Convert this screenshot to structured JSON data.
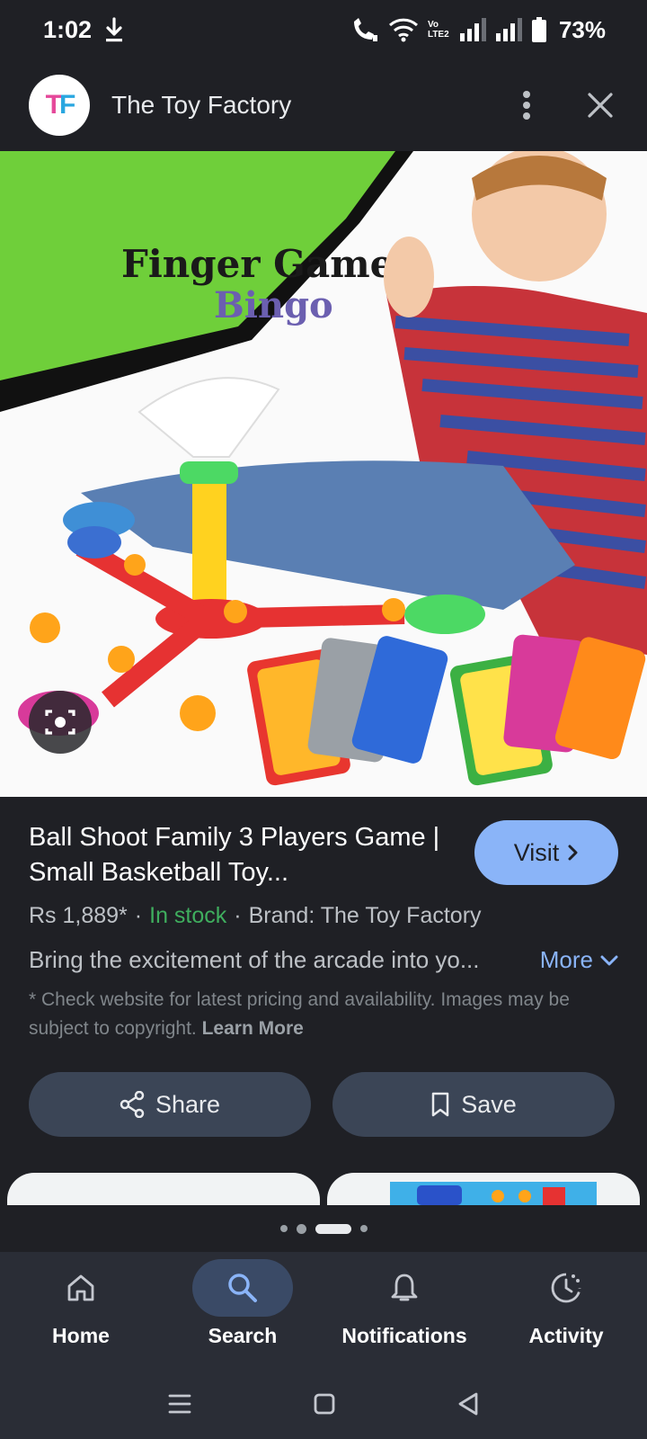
{
  "status": {
    "time": "1:02",
    "battery": "73%",
    "network_label": "Vo LTE2"
  },
  "header": {
    "logo_text_t": "T",
    "logo_text_f": "F",
    "site_name": "The Toy Factory"
  },
  "image": {
    "headline_line1": "Finger Games",
    "headline_line2": "Bingo"
  },
  "product": {
    "title": "Ball Shoot Family 3 Players Game | Small Basketball Toy...",
    "visit_label": "Visit",
    "price": "Rs 1,889*",
    "stock": "In stock",
    "brand": "Brand: The Toy Factory",
    "description": "Bring the excitement of the arcade into yo...",
    "more_label": "More",
    "disclaimer": "* Check website for latest pricing and availability. Images may be subject to copyright.",
    "learn_more": "Learn More",
    "share_label": "Share",
    "save_label": "Save"
  },
  "nav": {
    "items": [
      {
        "label": "Home",
        "icon": "home-icon"
      },
      {
        "label": "Search",
        "icon": "search-icon",
        "active": true
      },
      {
        "label": "Notifications",
        "icon": "bell-icon"
      },
      {
        "label": "Activity",
        "icon": "activity-icon"
      }
    ]
  },
  "colors": {
    "accent": "#8ab4f8",
    "stock_green": "#3fae5e",
    "background": "#1f2025",
    "button_bg": "#3b4556"
  }
}
